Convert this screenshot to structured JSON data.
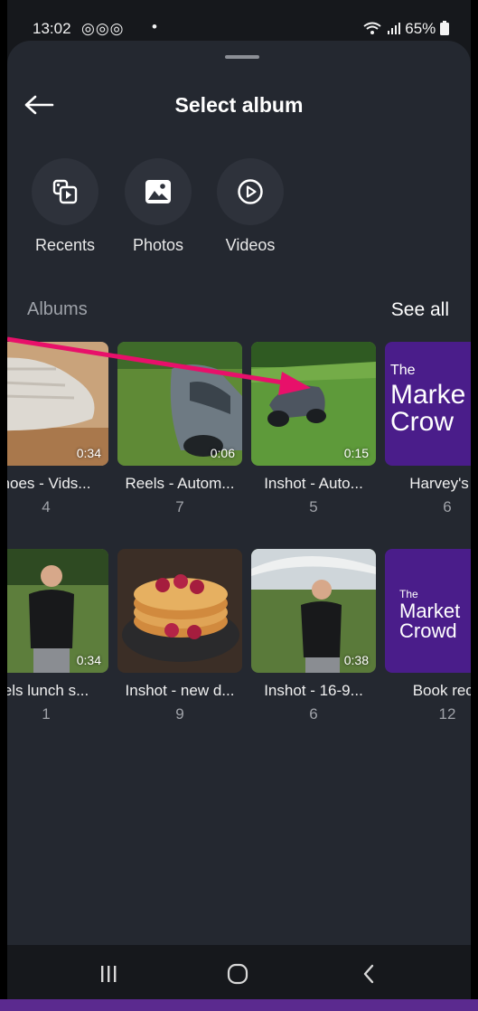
{
  "status_bar": {
    "time": "13:02",
    "left_icons": "◎◎◎",
    "dot": "•",
    "right": "65%"
  },
  "sheet": {
    "title": "Select album"
  },
  "quick_access": [
    {
      "label": "Recents",
      "icon": "recents-icon"
    },
    {
      "label": "Photos",
      "icon": "photo-icon"
    },
    {
      "label": "Videos",
      "icon": "play-icon"
    }
  ],
  "albums_section": {
    "heading": "Albums",
    "see_all": "See all"
  },
  "albums": [
    {
      "name": "hoes - Vids...",
      "count": "4",
      "duration": "0:34"
    },
    {
      "name": "Reels - Autom...",
      "count": "7",
      "duration": "0:06"
    },
    {
      "name": "Inshot - Auto...",
      "count": "5",
      "duration": "0:15"
    },
    {
      "name": "Harvey's G",
      "count": "6",
      "duration": "",
      "brand_lines": [
        "The",
        "Marke",
        "Crow"
      ]
    },
    {
      "name": "els lunch s...",
      "count": "1",
      "duration": "0:34"
    },
    {
      "name": "Inshot - new d...",
      "count": "9",
      "duration": ""
    },
    {
      "name": "Inshot - 16-9...",
      "count": "6",
      "duration": "0:38"
    },
    {
      "name": "Book reco",
      "count": "12",
      "duration": "",
      "brand_lines": [
        "The",
        "Market",
        "Crowd"
      ]
    }
  ],
  "colors": {
    "annotation_arrow": "#e8106a",
    "sheet_bg": "#242830",
    "brand_purple": "#4a1d8a"
  }
}
